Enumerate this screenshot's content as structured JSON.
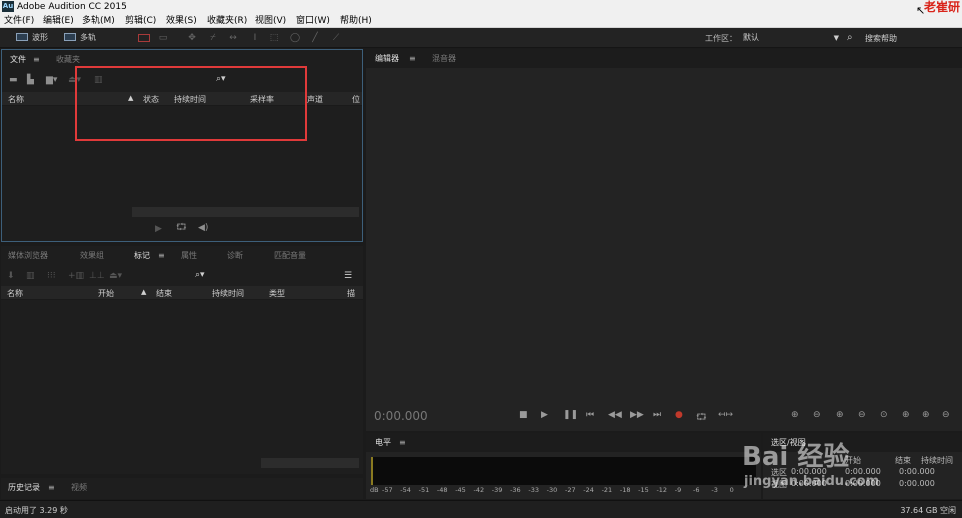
{
  "app": {
    "title": "Adobe Audition CC 2015",
    "icon_text": "Au"
  },
  "menus": [
    "文件(F)",
    "编辑(E)",
    "多轨(M)",
    "剪辑(C)",
    "效果(S)",
    "收藏夹(R)",
    "视图(V)",
    "窗口(W)",
    "帮助(H)"
  ],
  "toolbar": {
    "waveform_label": "波形",
    "multitrack_label": "多轨",
    "workspace_label": "工作区：",
    "workspace_value": "默认",
    "search_help_label": "搜索帮助"
  },
  "files_panel": {
    "tabs": [
      "文件",
      "收藏夹"
    ],
    "tab_menu": "≡",
    "columns": [
      "名称",
      "状态",
      "持续时间",
      "采样率",
      "声道",
      "位"
    ],
    "search_icon": "⌕"
  },
  "markers_panel": {
    "tabs": [
      "媒体浏览器",
      "效果组",
      "标记",
      "属性",
      "诊断",
      "匹配音量"
    ],
    "columns": [
      "名称",
      "开始",
      "结束",
      "持续时间",
      "类型",
      "描"
    ]
  },
  "history_panel": {
    "tabs": [
      "历史记录",
      "视频"
    ]
  },
  "editor_panel": {
    "tabs": [
      "编辑器",
      "混音器"
    ],
    "time": "0:00.000"
  },
  "levels_panel": {
    "title": "电平",
    "scale": [
      "dB",
      "-57",
      "-54",
      "-51",
      "-48",
      "-45",
      "-42",
      "-39",
      "-36",
      "-33",
      "-30",
      "-27",
      "-24",
      "-21",
      "-18",
      "-15",
      "-12",
      "-9",
      "-6",
      "-3",
      "0"
    ]
  },
  "selection_panel": {
    "title": "选区/视图",
    "headers": [
      "开始",
      "结束",
      "持续时间"
    ],
    "rows": [
      {
        "label": "选区",
        "start": "0:00.000",
        "end": "0:00.000",
        "duration": "0:00.000"
      },
      {
        "label": "视图",
        "start": "0:00.000",
        "end": "0:00.000",
        "duration": "0:00.000"
      }
    ]
  },
  "status": {
    "left": "启动用了 3.29 秒",
    "right": "37.64 GB 空闲"
  },
  "watermark": {
    "text": "Bai 经验",
    "url": "jingyan.baidu.com",
    "corner": "老崔研"
  },
  "colors": {
    "highlight": "#e03a3a",
    "record": "#c0392b",
    "accent_border": "#3d5f7a"
  }
}
